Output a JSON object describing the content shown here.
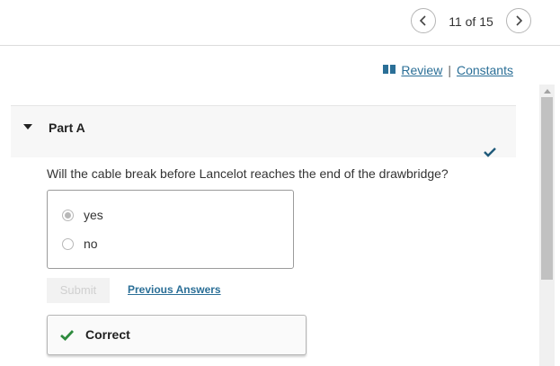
{
  "nav": {
    "counter": "11 of 15",
    "prev_icon": "chevron-left-icon",
    "next_icon": "chevron-right-icon"
  },
  "links": {
    "review": "Review",
    "separator": "|",
    "constants": "Constants",
    "review_icon": "book-icon"
  },
  "part": {
    "title": "Part A",
    "status_icon": "checkmark-icon",
    "question": "Will the cable break before Lancelot reaches the end of the drawbridge?"
  },
  "options": [
    {
      "label": "yes",
      "selected": true
    },
    {
      "label": "no",
      "selected": false
    }
  ],
  "actions": {
    "submit": "Submit",
    "previous_answers": "Previous Answers"
  },
  "result": {
    "text": "Correct",
    "icon": "checkmark-icon"
  },
  "colors": {
    "link": "#2b6f97",
    "check_small": "#1f5a7a",
    "check_correct": "#2e8b3e"
  }
}
